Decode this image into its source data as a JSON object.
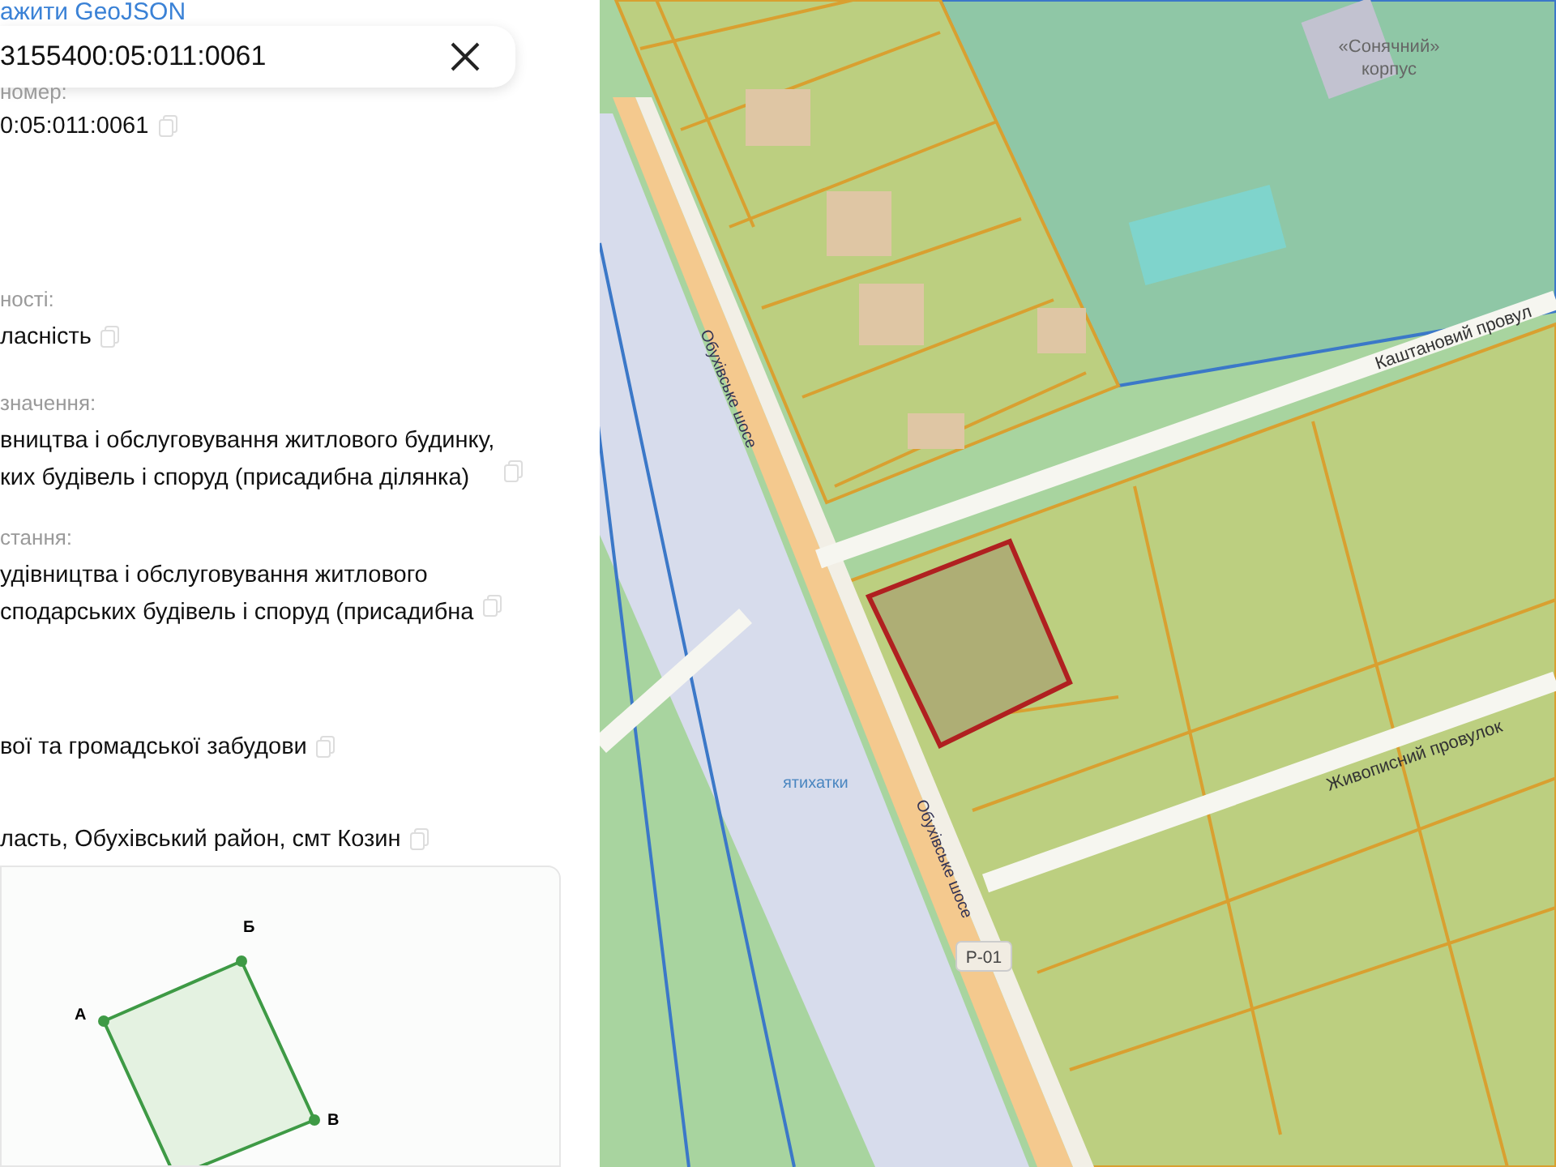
{
  "panel": {
    "link": "ажити GeoJSON",
    "search": {
      "value": "3155400:05:011:0061"
    },
    "number_label": "номер:",
    "fields": [
      {
        "lines": [
          "0:05:011:0061"
        ]
      },
      {
        "label": "ності:",
        "lines": [
          "ласність"
        ]
      },
      {
        "label": "значення:",
        "lines": [
          "вництва і обслуговування житлового будинку,",
          "ких будівель і споруд (присадибна ділянка)"
        ]
      },
      {
        "label": "стання:",
        "lines": [
          "удівництва і обслуговування житлового",
          "сподарських будівель і споруд (присадибна"
        ]
      },
      {
        "lines": [
          "вої та громадської забудови"
        ]
      },
      {
        "lines": [
          "ласть, Обухівський район, смт Козин"
        ]
      }
    ],
    "plan": {
      "vertices": [
        "А",
        "Б",
        "В"
      ]
    }
  },
  "map": {
    "labels": [
      {
        "kind": "place",
        "text": "«Сонячний»"
      },
      {
        "kind": "place",
        "text": "корпус"
      },
      {
        "kind": "street",
        "text": "Каштановий провул"
      },
      {
        "kind": "road",
        "text": "Обухівське шосе"
      },
      {
        "kind": "street",
        "text": "Живописний провулок"
      },
      {
        "kind": "stop",
        "text": "ятихатки"
      },
      {
        "kind": "road",
        "text": "Обухівське шосе"
      },
      {
        "kind": "shield",
        "text": "Р-01"
      }
    ]
  }
}
